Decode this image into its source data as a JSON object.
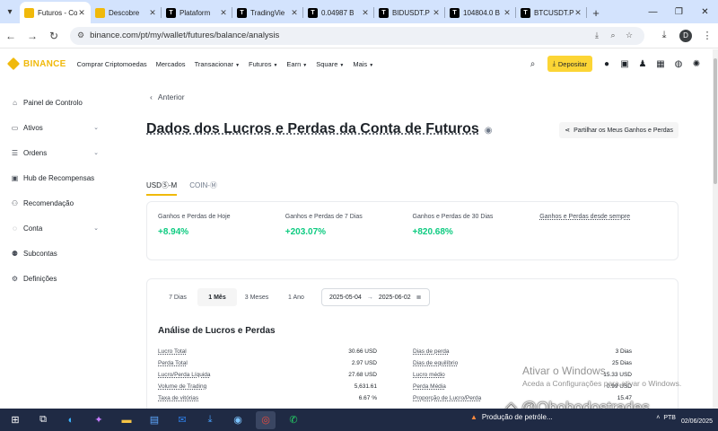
{
  "browser": {
    "tabs": [
      {
        "title": "Futuros - Co",
        "icon": "binance-icon",
        "active": true,
        "color": "#f0b90b"
      },
      {
        "title": "Descobre",
        "icon": "binance-icon",
        "active": false,
        "color": "#f0b90b"
      },
      {
        "title": "Plataform",
        "icon": "tradingview-icon",
        "active": false,
        "color": "#000000"
      },
      {
        "title": "TradingVie",
        "icon": "tradingview-icon",
        "active": false,
        "color": "#000000"
      },
      {
        "title": "0.04987 B",
        "icon": "tradingview-icon",
        "active": false,
        "color": "#000000"
      },
      {
        "title": "BIDUSDT.P",
        "icon": "tradingview-icon",
        "active": false,
        "color": "#000000"
      },
      {
        "title": "104804.0 B",
        "icon": "tradingview-icon",
        "active": false,
        "color": "#000000"
      },
      {
        "title": "BTCUSDT.P",
        "icon": "tradingview-icon",
        "active": false,
        "color": "#000000"
      }
    ],
    "url": "binance.com/pt/my/wallet/futures/balance/analysis",
    "profile_initial": "D"
  },
  "header": {
    "logo": "BINANCE",
    "nav": [
      "Comprar Criptomoedas",
      "Mercados",
      "Transacionar",
      "Futuros",
      "Earn",
      "Square",
      "Mais"
    ],
    "deposit_label": "Depositar"
  },
  "sidebar": {
    "items": [
      {
        "label": "Painel de Controlo",
        "icon": "dashboard-icon",
        "expandable": false
      },
      {
        "label": "Ativos",
        "icon": "wallet-icon",
        "expandable": true
      },
      {
        "label": "Ordens",
        "icon": "orders-icon",
        "expandable": true
      },
      {
        "label": "Hub de Recompensas",
        "icon": "rewards-icon",
        "expandable": false
      },
      {
        "label": "Recomendação",
        "icon": "referral-icon",
        "expandable": false
      },
      {
        "label": "Conta",
        "icon": "account-icon",
        "expandable": true
      },
      {
        "label": "Subcontas",
        "icon": "subaccounts-icon",
        "expandable": false
      },
      {
        "label": "Definições",
        "icon": "settings-icon",
        "expandable": false
      }
    ]
  },
  "main": {
    "back_label": "Anterior",
    "title": "Dados dos Lucros e Perdas da Conta de Futuros",
    "share_label": "Partilhar os Meus Ganhos e Perdas",
    "tabs": [
      "USDⓈ-M",
      "COIN-Ⓜ"
    ],
    "pnl": [
      {
        "label": "Ganhos e Perdas de Hoje",
        "value": "+8.94%"
      },
      {
        "label": "Ganhos e Perdas de 7 Dias",
        "value": "+203.07%"
      },
      {
        "label": "Ganhos e Perdas de 30 Dias",
        "value": "+820.68%"
      },
      {
        "label": "Ganhos e Perdas desde sempre",
        "value": ""
      }
    ],
    "ranges": [
      "7 Dias",
      "1 Mês",
      "3 Meses",
      "1 Ano"
    ],
    "active_range": "1 Mês",
    "date_from": "2025-05-04",
    "date_to": "2025-06-02",
    "analysis_title": "Análise de Lucros e Perdas",
    "stats_left": [
      {
        "k": "Lucro Total",
        "v": "30.66 USD"
      },
      {
        "k": "Perda Total",
        "v": "2.97 USD"
      },
      {
        "k": "Lucro/Perda Líquida",
        "v": "27.68 USD"
      },
      {
        "k": "Volume de Trading",
        "v": "5,631.61"
      },
      {
        "k": "Taxa de vitórias",
        "v": "6.67 %"
      }
    ],
    "stats_right": [
      {
        "k": "Dias de perda",
        "v": "3 Dias"
      },
      {
        "k": "Dias de equilíbrio",
        "v": "25 Dias"
      },
      {
        "k": "Lucro médio",
        "v": "15.33 USD"
      },
      {
        "k": "Perda Média",
        "v": "0.99 USD"
      },
      {
        "k": "Proporção de Lucro/Perda",
        "v": "15.47"
      }
    ]
  },
  "watermark": {
    "line1": "Ativar o Windows",
    "line2": "Aceda a Configurações para ativar o Windows.",
    "overlay": "@Obobodostrades"
  },
  "taskbar": {
    "news": "Produção de petróle...",
    "lang": "PTB",
    "date": "02/06/2025"
  },
  "colors": {
    "accent": "#f0b90b",
    "positive": "#0ecb81"
  }
}
